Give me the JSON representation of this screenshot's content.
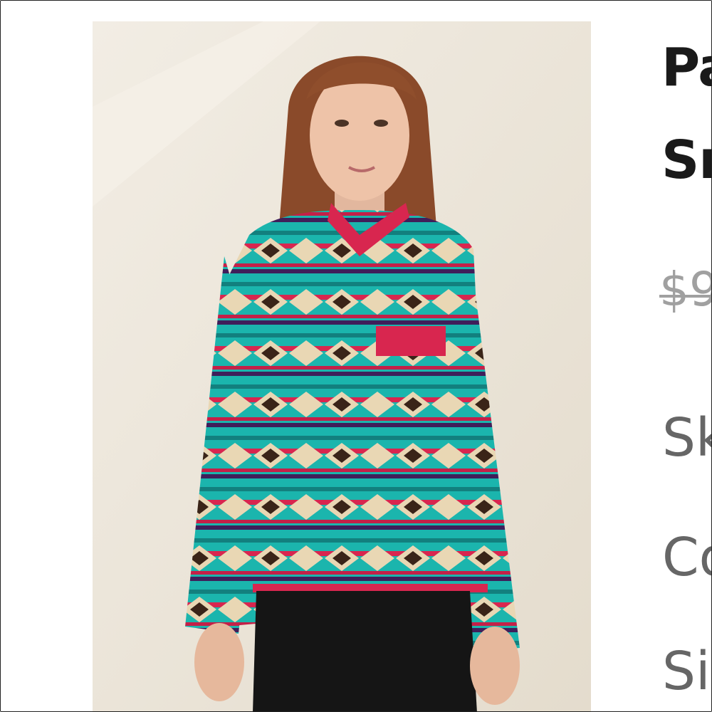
{
  "listing": {
    "title_line1": "Pa",
    "title_line2": "Sn",
    "price": "$9",
    "attributes": [
      "Sk",
      "Co",
      "Si"
    ]
  },
  "colors": {
    "background": "#ebe3d6",
    "sweater_teal": "#1bb5ad",
    "trim_red": "#d8264f",
    "pants": "#151515"
  }
}
